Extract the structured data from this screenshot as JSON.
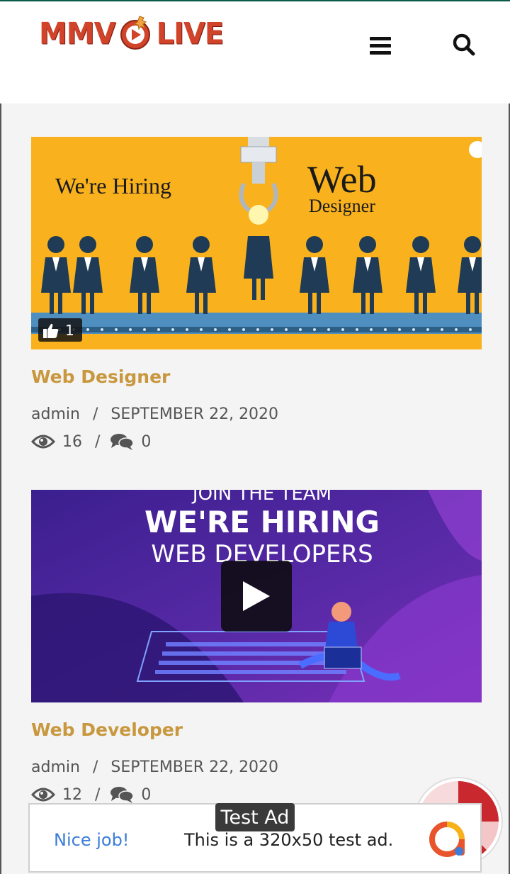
{
  "brand": {
    "logo_left": "MMV",
    "logo_right": "LIVE"
  },
  "header": {
    "menu_icon": "hamburger-menu-icon",
    "search_icon": "search-icon"
  },
  "posts": [
    {
      "image_text": {
        "left": "We're Hiring",
        "right_big": "Web",
        "right_small": "Designer"
      },
      "likes": "1",
      "title": "Web Designer",
      "author": "admin",
      "date": "SEPTEMBER 22, 2020",
      "views": "16",
      "comments": "0"
    },
    {
      "image_text": {
        "line1": "JOIN THE TEAM",
        "line2": "WE'RE HIRING",
        "line3": "WEB DEVELOPERS"
      },
      "title": "Web Developer",
      "author": "admin",
      "date": "SEPTEMBER 22, 2020",
      "views": "12",
      "comments": "0"
    }
  ],
  "ad": {
    "label": "Test Ad",
    "nice": "Nice job!",
    "description": "This is a 320x50 test ad."
  },
  "colors": {
    "accent": "#c8973e",
    "brand_red": "#d2442a",
    "ad_blue": "#3b7dd8"
  }
}
